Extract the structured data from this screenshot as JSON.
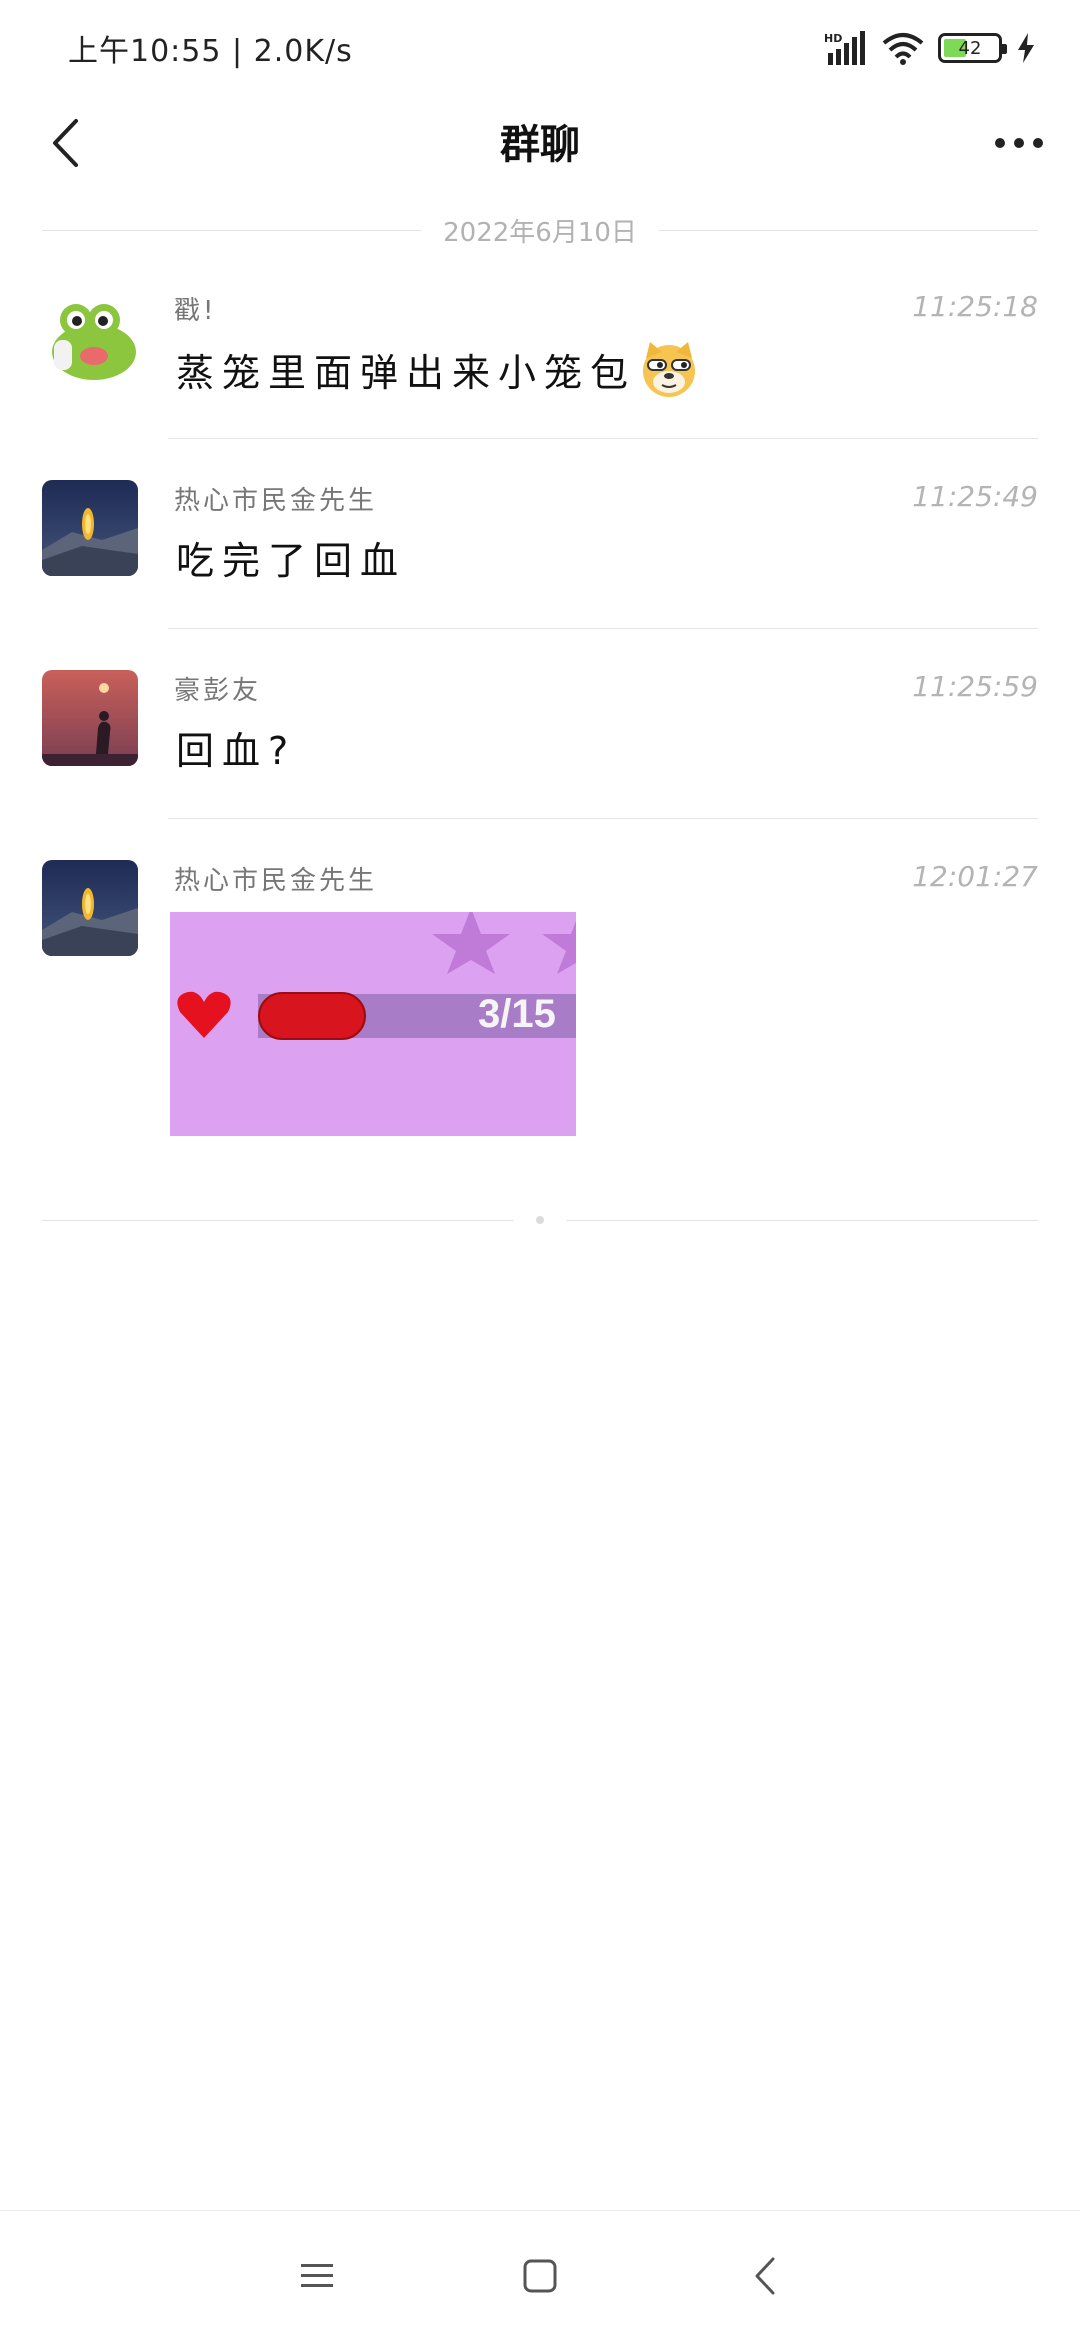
{
  "status_bar": {
    "time_speed": "上午10:55 | 2.0K/s",
    "network_label": "HD",
    "battery_level": "42",
    "battery_fraction": 0.42
  },
  "header": {
    "title": "群聊"
  },
  "date_divider": "2022年6月10日",
  "messages": [
    {
      "sender": "戳!",
      "time": "11:25:18",
      "text": "蒸笼里面弹出来小笼包",
      "avatar": "frog-avatar",
      "emoji": "doge-emoji"
    },
    {
      "sender": "热心市民金先生",
      "time": "11:25:49",
      "text": "吃完了回血",
      "avatar": "night-mountain-avatar"
    },
    {
      "sender": "豪彭友",
      "time": "11:25:59",
      "text": "回血?",
      "avatar": "sunset-avatar"
    },
    {
      "sender": "热心市民金先生",
      "time": "12:01:27",
      "avatar": "night-mountain-avatar",
      "image": {
        "health_text": "3/15",
        "health_fraction": 0.2
      }
    }
  ],
  "colors": {
    "image_bg": "#dda1f2",
    "health_red": "#d8141e",
    "battery_green": "#7ed957"
  },
  "nav_bar": {
    "icons": [
      "menu-icon",
      "home-icon",
      "back-icon"
    ]
  }
}
